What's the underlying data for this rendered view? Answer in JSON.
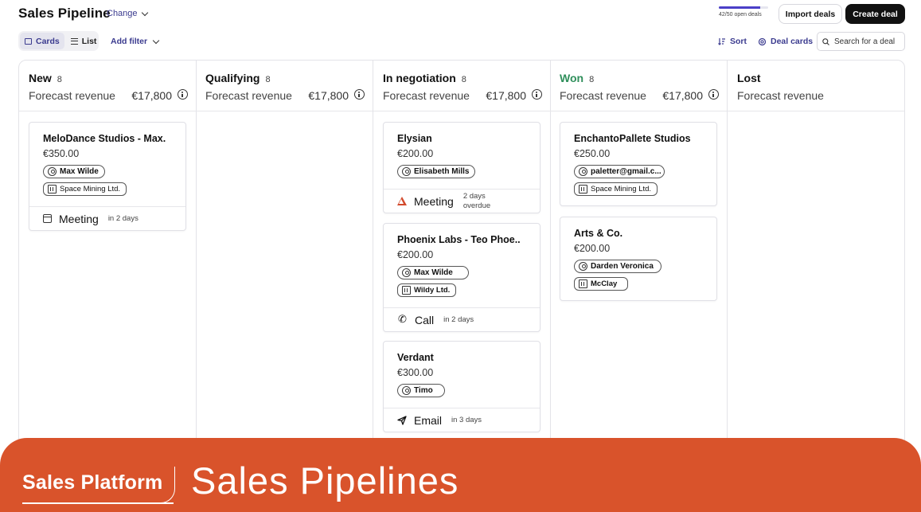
{
  "header": {
    "title": "Sales Pipeline",
    "change_label": "Change",
    "progress_label": "42/50 open deals",
    "progress_fraction": 0.84,
    "import_label": "Import deals",
    "create_label": "Create deal"
  },
  "toolbar": {
    "cards_label": "Cards",
    "list_label": "List",
    "add_filter_label": "Add filter",
    "sort_label": "Sort",
    "deal_cards_label": "Deal cards",
    "search_placeholder": "Search for a deal"
  },
  "columns": [
    {
      "name": "New",
      "count": "8",
      "forecast_label": "Forecast revenue",
      "forecast_amount": "€17,800"
    },
    {
      "name": "Qualifying",
      "count": "8",
      "forecast_label": "Forecast revenue",
      "forecast_amount": "€17,800"
    },
    {
      "name": "In negotiation",
      "count": "8",
      "forecast_label": "Forecast revenue",
      "forecast_amount": "€17,800"
    },
    {
      "name": "Won",
      "count": "8",
      "forecast_label": "Forecast revenue",
      "forecast_amount": "€17,800",
      "accent": "#2f8f5b"
    },
    {
      "name": "Lost",
      "forecast_label": "Forecast revenue"
    }
  ],
  "cards": {
    "new_1": {
      "name": "MeloDance Studios - Max...",
      "price": "€350.00",
      "contact": "Max Wilde",
      "org": "Space Mining Ltd.",
      "activity": "Meeting",
      "when": "in 2 days",
      "icon": "calendar-icon"
    },
    "neg_1": {
      "name": "Elysian",
      "price": "€200.00",
      "contact": "Elisabeth Mills",
      "activity": "Meeting",
      "when_line1": "2 days",
      "when_line2": "overdue",
      "icon": "warning-icon"
    },
    "neg_2": {
      "name": "Phoenix Labs - Teo Phoe...",
      "price": "€200.00",
      "contact": "Max Wilde",
      "org": "Wildy Ltd.",
      "activity": "Call",
      "when": "in 2 days",
      "icon": "phone-icon"
    },
    "neg_3": {
      "name": "Verdant",
      "price": "€300.00",
      "contact": "Timo",
      "activity": "Email",
      "when": "in 3 days",
      "icon": "send-icon"
    },
    "won_1": {
      "name": "EnchantoPallete Studios",
      "price": "€250.00",
      "contact": "paletter@gmail.c...",
      "org": "Space Mining Ltd."
    },
    "won_2": {
      "name": "Arts & Co.",
      "price": "€200.00",
      "contact": "Darden Veronica",
      "org": "McClay"
    }
  },
  "banner": {
    "brand": "Sales Platform",
    "title": "Sales Pipelines",
    "color": "#d9532b"
  }
}
